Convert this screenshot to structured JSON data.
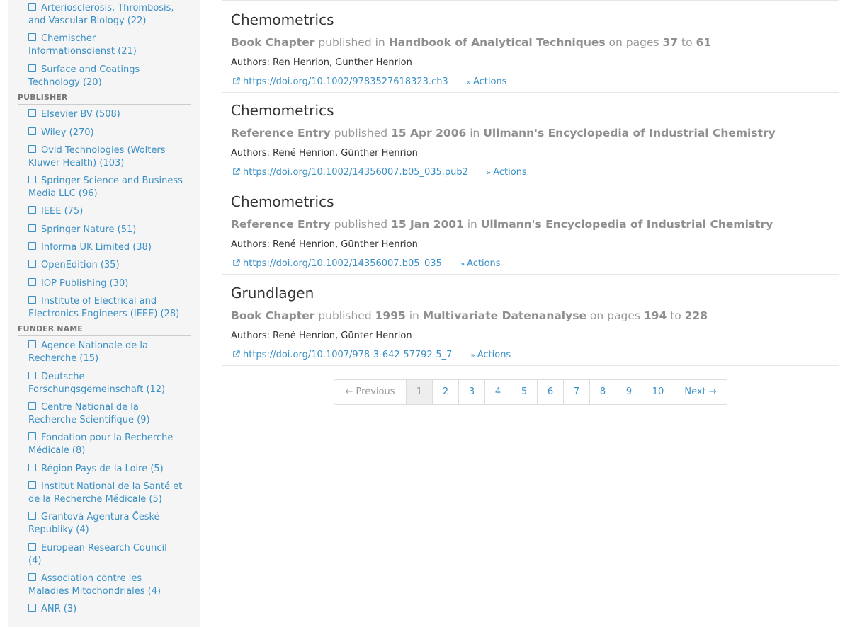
{
  "facets": {
    "journal_tail": [
      {
        "label": "Arteriosclerosis, Thrombosis, and Vascular Biology (22)"
      },
      {
        "label": "Chemischer Informationsdienst (21)"
      },
      {
        "label": "Surface and Coatings Technology (20)"
      }
    ],
    "publisher": {
      "heading": "PUBLISHER",
      "items": [
        {
          "label": "Elsevier BV (508)"
        },
        {
          "label": "Wiley (270)"
        },
        {
          "label": "Ovid Technologies (Wolters Kluwer Health) (103)"
        },
        {
          "label": "Springer Science and Business Media LLC (96)"
        },
        {
          "label": "IEEE (75)"
        },
        {
          "label": "Springer Nature (51)"
        },
        {
          "label": "Informa UK Limited (38)"
        },
        {
          "label": "OpenEdition (35)"
        },
        {
          "label": "IOP Publishing (30)"
        },
        {
          "label": "Institute of Electrical and Electronics Engineers (IEEE) (28)"
        }
      ]
    },
    "funder": {
      "heading": "FUNDER NAME",
      "items": [
        {
          "label": "Agence Nationale de la Recherche (15)"
        },
        {
          "label": "Deutsche Forschungsgemeinschaft (12)"
        },
        {
          "label": "Centre National de la Recherche Scientifique (9)"
        },
        {
          "label": "Fondation pour la Recherche Médicale (8)"
        },
        {
          "label": "Région Pays de la Loire (5)"
        },
        {
          "label": "Institut National de la Santé et de la Recherche Médicale (5)"
        },
        {
          "label": "Grantová Agentura České Republiky (4)"
        },
        {
          "label": "European Research Council (4)"
        },
        {
          "label": "Association contre les Maladies Mitochondriales (4)"
        },
        {
          "label": "ANR (3)"
        }
      ]
    }
  },
  "results": [
    {
      "title": "Chemometrics",
      "type": "Book Chapter",
      "published_word": "published",
      "in_word": "in",
      "container": "Handbook of Analytical Techniques",
      "pages_word": "on pages",
      "page_start": "37",
      "to_word": "to",
      "page_end": "61",
      "authors": "Authors: Ren Henrion, Gunther Henrion",
      "doi": "https://doi.org/10.1002/9783527618323.ch3",
      "actions": "Actions"
    },
    {
      "title": "Chemometrics",
      "type": "Reference Entry",
      "published_word": "published",
      "date": "15 Apr 2006",
      "in_word": "in",
      "container": "Ullmann's Encyclopedia of Industrial Chemistry",
      "authors": "Authors: René Henrion, Günther Henrion",
      "doi": "https://doi.org/10.1002/14356007.b05_035.pub2",
      "actions": "Actions"
    },
    {
      "title": "Chemometrics",
      "type": "Reference Entry",
      "published_word": "published",
      "date": "15 Jan 2001",
      "in_word": "in",
      "container": "Ullmann's Encyclopedia of Industrial Chemistry",
      "authors": "Authors: René Henrion, Günther Henrion",
      "doi": "https://doi.org/10.1002/14356007.b05_035",
      "actions": "Actions"
    },
    {
      "title": "Grundlagen",
      "type": "Book Chapter",
      "published_word": "published",
      "date": "1995",
      "in_word": "in",
      "container": "Multivariate Datenanalyse",
      "pages_word": "on pages",
      "page_start": "194",
      "to_word": "to",
      "page_end": "228",
      "authors": "Authors: René Henrion, Günter Henrion",
      "doi": "https://doi.org/10.1007/978-3-642-57792-5_7",
      "actions": "Actions"
    }
  ],
  "pagination": {
    "previous": "← Previous",
    "pages": [
      "1",
      "2",
      "3",
      "4",
      "5",
      "6",
      "7",
      "8",
      "9",
      "10"
    ],
    "current": "1",
    "next": "Next →"
  },
  "icons": {
    "checkbox": "checkbox-empty-icon",
    "external_link": "external-link-icon",
    "actions_chevron": "double-chevron-down-icon"
  },
  "colors": {
    "link": "#3a8fc4",
    "sidebar_bg": "#f5f5f5",
    "meta_text": "#999999"
  }
}
